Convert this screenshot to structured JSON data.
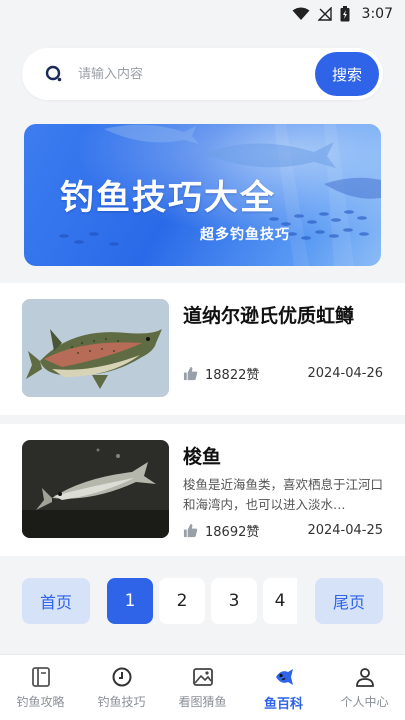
{
  "status_bar": {
    "time": "3:07"
  },
  "search": {
    "placeholder": "请输入内容",
    "button_label": "搜索"
  },
  "banner": {
    "title": "钓鱼技巧大全",
    "subtitle": "超多钓鱼技巧"
  },
  "articles": [
    {
      "title": "道纳尔逊氏优质虹鳟",
      "description": "",
      "likes": "18822赞",
      "date": "2024-04-26"
    },
    {
      "title": "梭鱼",
      "description": "梭鱼是近海鱼类，喜欢栖息于江河口和海湾内，也可以进入淡水…",
      "likes": "18692赞",
      "date": "2024-04-25"
    }
  ],
  "pagination": {
    "first": "首页",
    "last": "尾页",
    "pages": [
      "1",
      "2",
      "3",
      "4"
    ],
    "current": "1"
  },
  "tabs": [
    {
      "label": "钓鱼攻略",
      "icon": "book-icon",
      "active": false
    },
    {
      "label": "钓鱼技巧",
      "icon": "clock-icon",
      "active": false
    },
    {
      "label": "看图猜鱼",
      "icon": "image-icon",
      "active": false
    },
    {
      "label": "鱼百科",
      "icon": "fish-icon",
      "active": true
    },
    {
      "label": "个人中心",
      "icon": "person-icon",
      "active": false
    }
  ],
  "colors": {
    "accent": "#2f64e8",
    "accent_light": "#d6e2f7",
    "background": "#f3f4f6"
  }
}
